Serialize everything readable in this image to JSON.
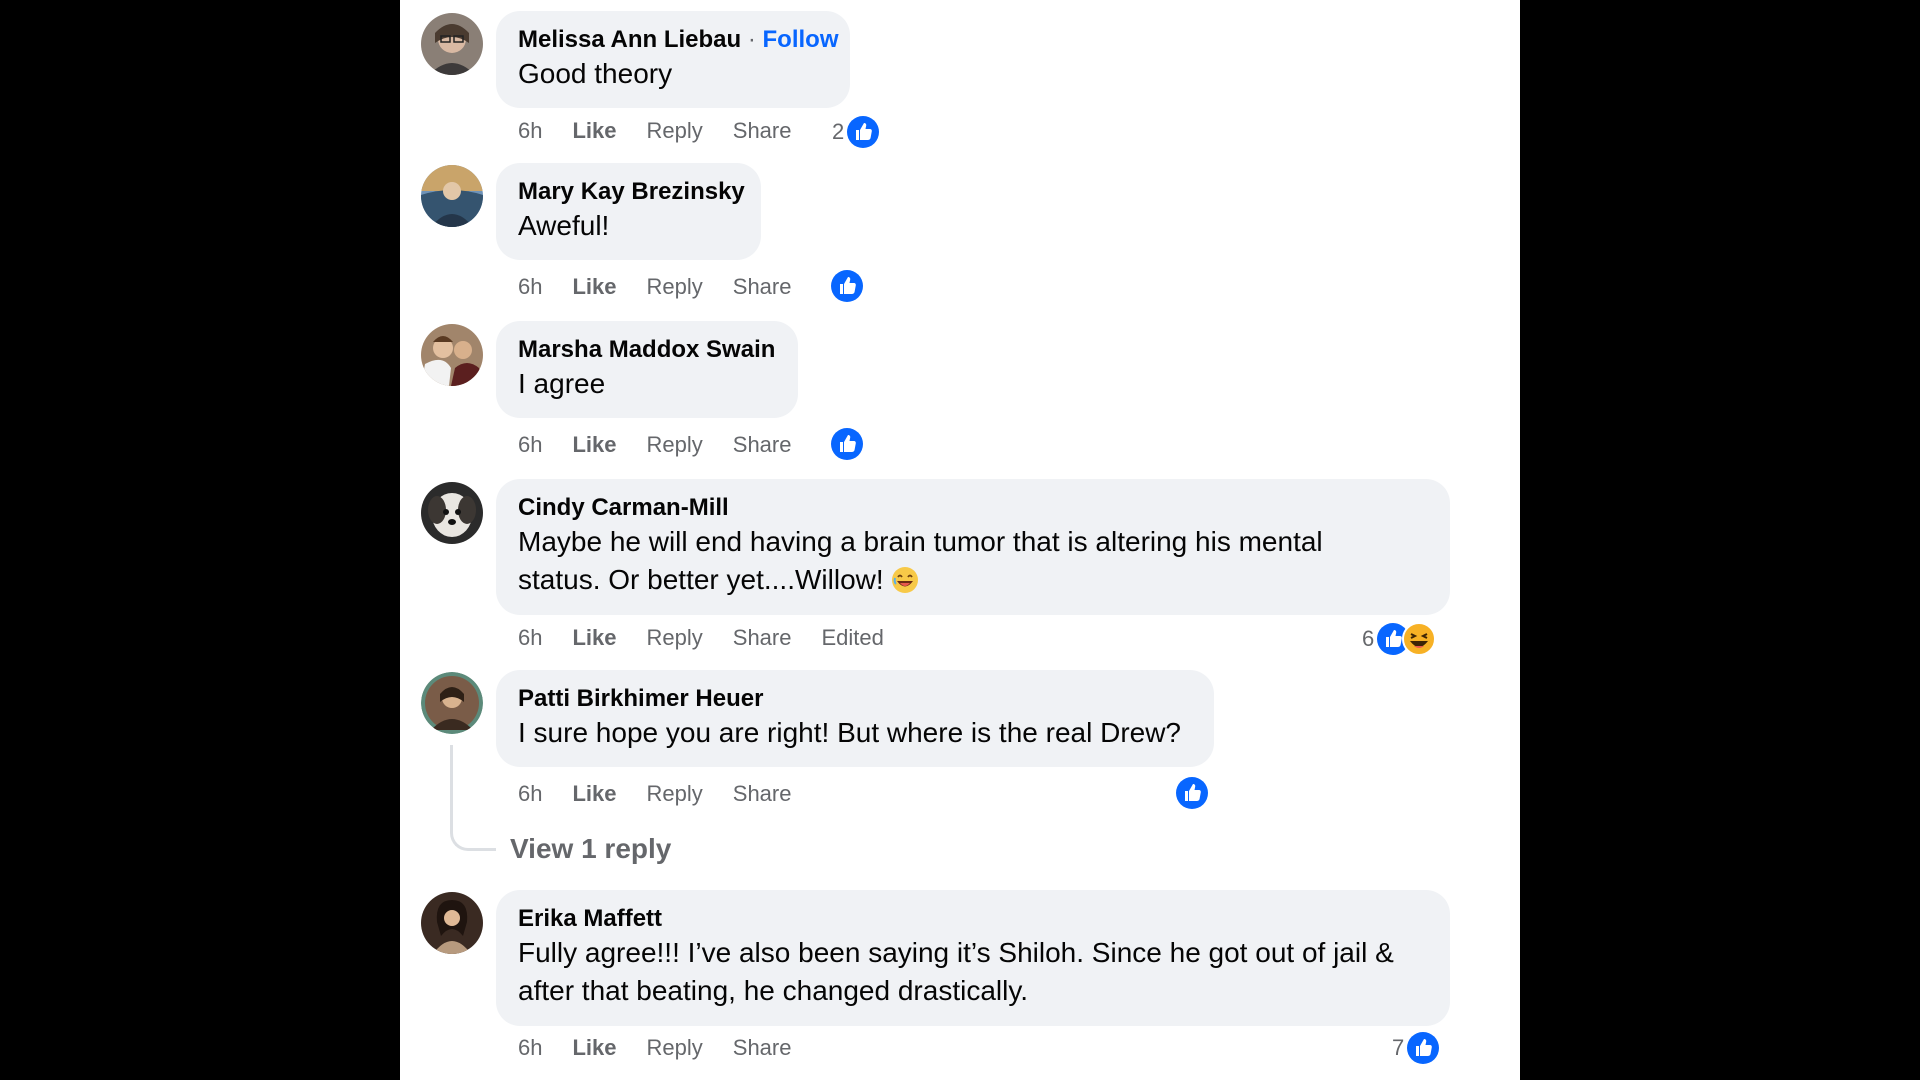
{
  "colors": {
    "like_blue": "#0866ff",
    "bubble_bg": "#f0f2f5",
    "meta_gray": "#65676b",
    "haha_yellow": "#f7b125"
  },
  "comments": [
    {
      "author": "Melissa Ann Liebau",
      "separator": "·",
      "follow": "Follow",
      "text": "Good theory",
      "time": "6h",
      "like": "Like",
      "reply": "Reply",
      "share": "Share",
      "reaction_count": "2",
      "reactions": [
        "like-icon"
      ]
    },
    {
      "author": "Mary Kay Brezinsky",
      "text": "Aweful!",
      "time": "6h",
      "like": "Like",
      "reply": "Reply",
      "share": "Share",
      "reactions": [
        "like-icon"
      ]
    },
    {
      "author": "Marsha Maddox Swain",
      "text": "I agree",
      "time": "6h",
      "like": "Like",
      "reply": "Reply",
      "share": "Share",
      "reactions": [
        "like-icon"
      ]
    },
    {
      "author": "Cindy Carman-Mill",
      "text_line1": "Maybe he will end having a brain tumor that is altering his mental",
      "text_line2": "status. Or better yet....Willow!",
      "time": "6h",
      "like": "Like",
      "reply": "Reply",
      "share": "Share",
      "edited": "Edited",
      "reaction_count": "6",
      "reactions": [
        "like-icon",
        "haha-icon"
      ]
    },
    {
      "author": "Patti Birkhimer Heuer",
      "text": "I sure hope you are right! But where is the real Drew?",
      "time": "6h",
      "like": "Like",
      "reply": "Reply",
      "share": "Share",
      "reactions": [
        "like-icon"
      ],
      "view_replies": "View 1 reply"
    },
    {
      "author": "Erika Maffett",
      "text_line1": "Fully agree!!! I’ve also been saying it’s Shiloh. Since he got out of jail &",
      "text_line2": "after that beating, he changed drastically.",
      "time": "6h",
      "like": "Like",
      "reply": "Reply",
      "share": "Share",
      "reaction_count": "7",
      "reactions": [
        "like-icon"
      ]
    }
  ]
}
